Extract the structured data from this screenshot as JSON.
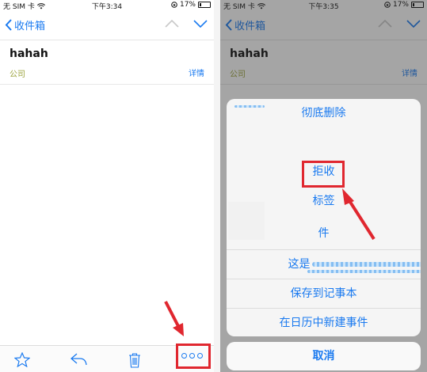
{
  "left": {
    "status": {
      "carrier": "无 SIM 卡",
      "time": "下午3:34",
      "battery": "17%"
    },
    "nav": {
      "back_label": "收件箱"
    },
    "message": {
      "subject": "hahah",
      "sender": "公司",
      "details_link": "详情"
    }
  },
  "right": {
    "status": {
      "carrier": "无 SIM 卡",
      "time": "下午3:35",
      "battery": "17%"
    },
    "nav": {
      "back_label": "收件箱"
    },
    "message": {
      "subject": "hahah",
      "sender": "公司",
      "details_link": "详情"
    },
    "action_sheet": {
      "items": [
        {
          "label": "彻底删除"
        },
        {
          "label": ""
        },
        {
          "label": "拒收"
        },
        {
          "label": "标签"
        },
        {
          "label": "件"
        },
        {
          "label": "这是"
        },
        {
          "label": "保存到记事本"
        },
        {
          "label": "在日历中新建事件"
        }
      ],
      "cancel": "取消"
    }
  },
  "colors": {
    "accent": "#1a7af0",
    "sender": "#9aa23a",
    "highlight": "#e0272f"
  }
}
